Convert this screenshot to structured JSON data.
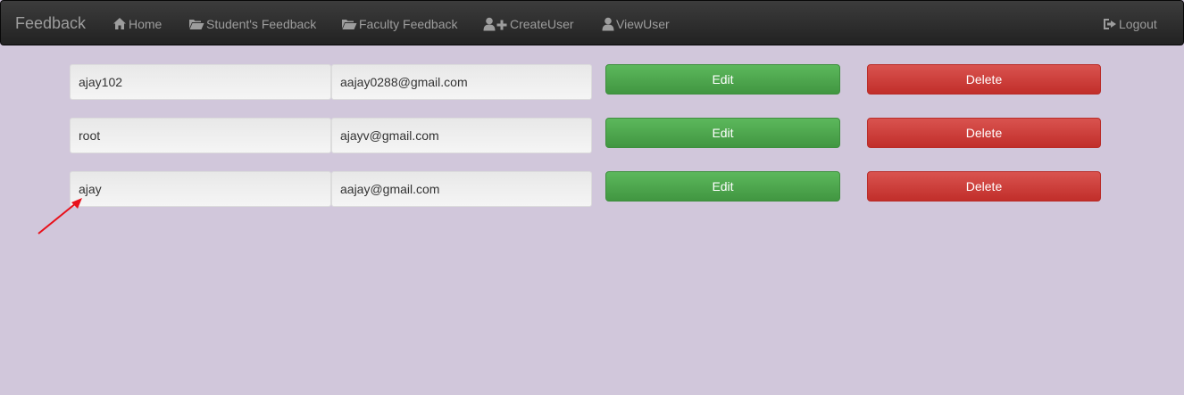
{
  "navbar": {
    "brand": "Feedback",
    "items": [
      {
        "label": "Home",
        "icon": "home-icon"
      },
      {
        "label": "Student's Feedback",
        "icon": "folder-open-icon"
      },
      {
        "label": "Faculty Feedback",
        "icon": "folder-open-icon"
      },
      {
        "label": "CreateUser",
        "icon": "user-plus-icon"
      },
      {
        "label": "ViewUser",
        "icon": "user-icon"
      }
    ],
    "logout": {
      "label": "Logout",
      "icon": "logout-icon"
    }
  },
  "users": [
    {
      "username": "ajay102",
      "email": "aajay0288@gmail.com",
      "edit_label": "Edit",
      "delete_label": "Delete"
    },
    {
      "username": "root",
      "email": "ajayv@gmail.com",
      "edit_label": "Edit",
      "delete_label": "Delete"
    },
    {
      "username": "ajay",
      "email": "aajay@gmail.com",
      "edit_label": "Edit",
      "delete_label": "Delete"
    }
  ],
  "colors": {
    "background": "#d1c7db",
    "navbar": "#222222",
    "nav_text": "#9d9d9d",
    "edit_button": "#5cb85c",
    "delete_button": "#d9534f",
    "annotation_arrow": "#e8111b"
  }
}
